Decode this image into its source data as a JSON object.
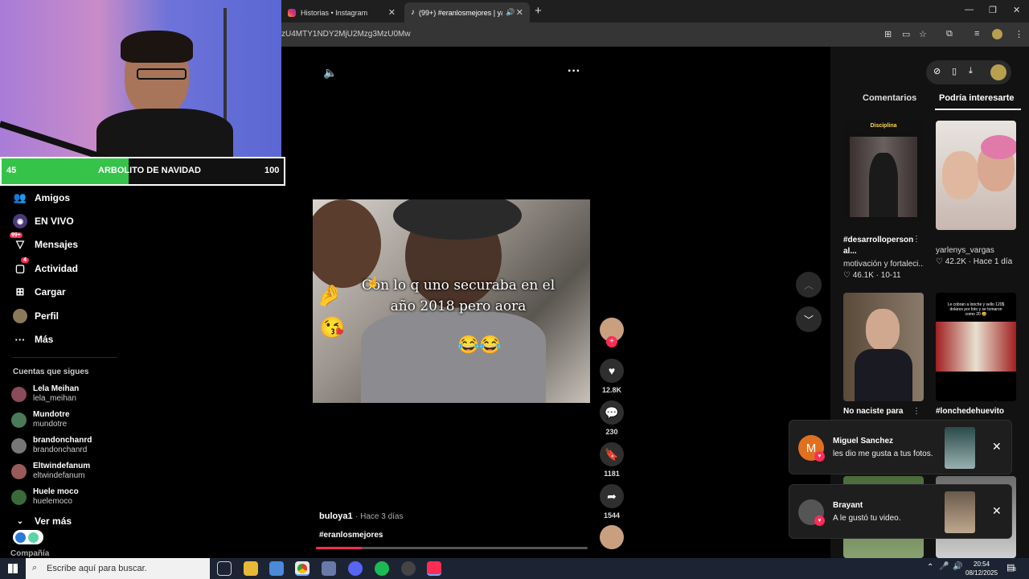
{
  "browser": {
    "tabs": [
      {
        "label": "Historias • Instagram",
        "active": false
      },
      {
        "label": "(99+) #eranlosmejores | yai",
        "active": true
      }
    ],
    "url": "zU4MTY1NDY2MjU2Mzg3MzU0Mw",
    "icons": [
      "translate-icon",
      "cast-icon",
      "star-icon",
      "extensions-icon",
      "playlist-icon",
      "profile-icon",
      "menu-icon"
    ]
  },
  "goal": {
    "current": "45",
    "label": "ARBOLITO DE NAVIDAD",
    "target": "100",
    "progress": 0.45
  },
  "nav": [
    {
      "label": "Amigos",
      "icon": "friends-icon"
    },
    {
      "label": "EN VIVO",
      "icon": "live-icon"
    },
    {
      "label": "Mensajes",
      "icon": "messages-icon",
      "badge": "99+"
    },
    {
      "label": "Actividad",
      "icon": "activity-icon",
      "badge": "4"
    },
    {
      "label": "Cargar",
      "icon": "upload-icon"
    },
    {
      "label": "Perfil",
      "icon": "profile-icon"
    },
    {
      "label": "Más",
      "icon": "more-icon"
    }
  ],
  "following": {
    "title": "Cuentas que sigues",
    "accounts": [
      {
        "name": "Lela Meihan",
        "handle": "lela_meihan",
        "color": "#8a4b5a"
      },
      {
        "name": "Mundotre",
        "handle": "mundotre",
        "color": "#4a7a5a"
      },
      {
        "name": "brandonchanrd",
        "handle": "brandonchanrd",
        "color": "#777"
      },
      {
        "name": "Eltwindefanum",
        "handle": "eltwindefanum",
        "color": "#9a5a5a"
      },
      {
        "name": "Huele moco",
        "handle": "huelemoco",
        "color": "#3a6a3a"
      }
    ],
    "see_more": "Ver más",
    "company": "Compañía"
  },
  "post": {
    "caption_lines": [
      "Con lo q uno securaba en el",
      "año 2018 pero aora"
    ],
    "author": "buloya1",
    "posted": "· Hace 3 días",
    "hashtag": "#eranlosmejores",
    "likes": "12.8K",
    "comments": "230",
    "saves": "1181",
    "shares": "1544",
    "progress": 0.17
  },
  "right": {
    "tabs": [
      "Comentarios",
      "Podría interesarte"
    ],
    "active_tab": "Podría interesarte",
    "cards": [
      {
        "thumb_text": "Disciplina",
        "title": "#desarrolloperson al...",
        "sub": "motivación y fortaleci...",
        "likes": "46.1K",
        "date": "10-11"
      },
      {
        "title": "yarlenys_vargas",
        "likes": "42.2K",
        "date": "Hace 1 día"
      },
      {
        "title": "No naciste para"
      },
      {
        "thumb_text": "Le cobran a lonche y sello 120$ dolares por foto y se tomaron como 20 😅",
        "title": "#lonchedehuevito"
      }
    ]
  },
  "notifications": [
    {
      "initial": "M",
      "name": "Miguel Sanchez",
      "message": "les dio me gusta a tus fotos.",
      "avatar_color": "#e07020"
    },
    {
      "name": "Brayant",
      "message": "A le gustó tu video.",
      "avatar_color": "#555"
    }
  ],
  "taskbar": {
    "search_placeholder": "Escribe aquí para buscar.",
    "time": "20:54",
    "date": "08/12/2025",
    "notif_count": "8"
  }
}
